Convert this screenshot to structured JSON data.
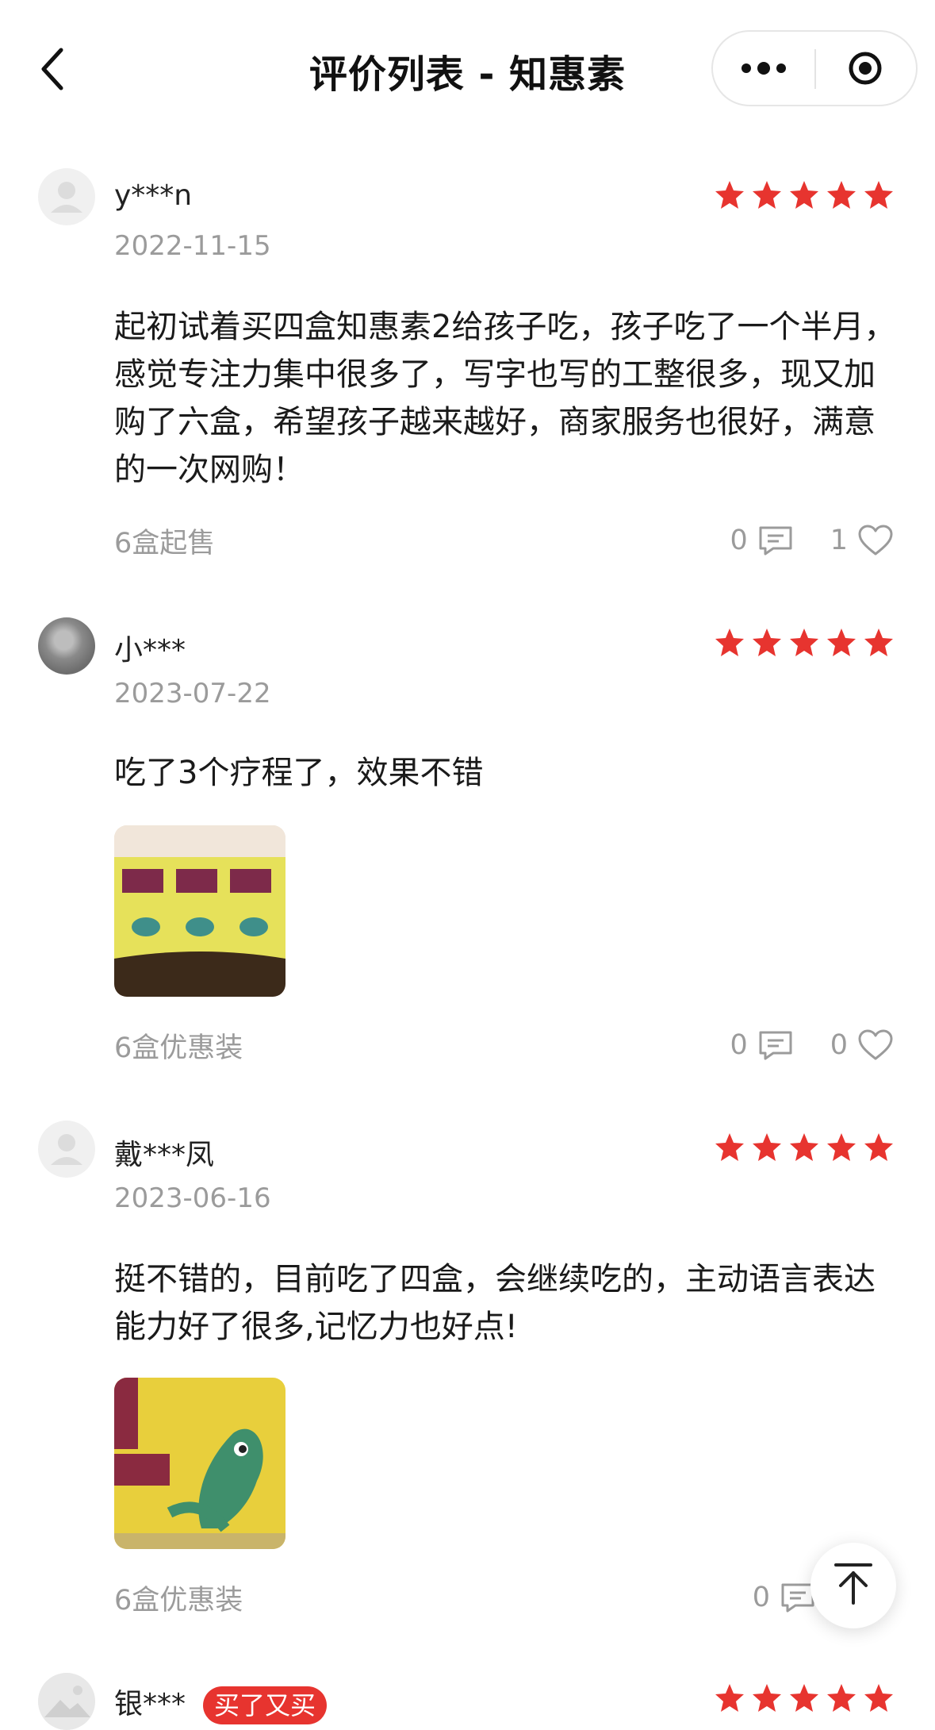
{
  "header": {
    "title": "评价列表 - 知惠素",
    "back_icon": "back-chevron",
    "more_icon": "more-dots",
    "target_icon": "record-target"
  },
  "colors": {
    "star": "#e7342f",
    "badge": "#e7342f",
    "muted": "#9b9b9b"
  },
  "reviews": [
    {
      "username": "y***n",
      "date": "2022-11-15",
      "rating": 5,
      "content": "起初试着买四盒知惠素2给孩子吃，孩子吃了一个半月，感觉专注力集中很多了，写字也写的工整很多，现又加购了六盒，希望孩子越来越好，商家服务也很好，满意的一次网购！",
      "spec": "6盒起售",
      "comment_count": "0",
      "like_count": "1"
    },
    {
      "username": "小***",
      "date": "2023-07-22",
      "rating": 5,
      "content": "吃了3个疗程了，效果不错",
      "spec": "6盒优惠装",
      "comment_count": "0",
      "like_count": "0"
    },
    {
      "username": "戴***凤",
      "date": "2023-06-16",
      "rating": 5,
      "content": "挺不错的，目前吃了四盒，会继续吃的，主动语言表达能力好了很多,记忆力也好点!",
      "spec": "6盒优惠装",
      "comment_count": "0"
    },
    {
      "username": "银***",
      "badge": "买了又买",
      "rating": 5
    }
  ],
  "back_to_top_icon": "arrow-up-to-top"
}
